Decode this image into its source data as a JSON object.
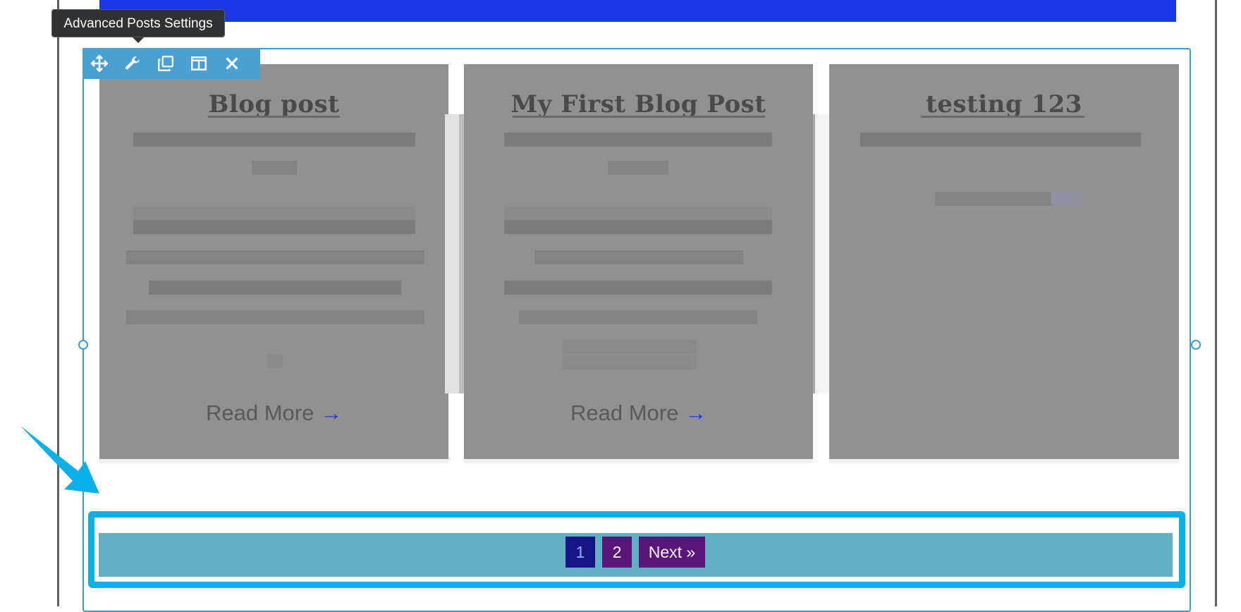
{
  "toolbar": {
    "tooltip": "Advanced Posts Settings",
    "tools": [
      "move-icon",
      "wrench-icon",
      "duplicate-icon",
      "columns-icon",
      "close-icon"
    ]
  },
  "posts": [
    {
      "title": "Blog post",
      "read_more": "Read More",
      "arrow": "→"
    },
    {
      "title": "My First Blog Post",
      "read_more": "Read More",
      "arrow": "→"
    },
    {
      "title": "testing 123"
    }
  ],
  "pagination": {
    "pages": [
      "1",
      "2"
    ],
    "current": "1",
    "next_label": "Next »"
  },
  "colors": {
    "banner": "#1b38e7",
    "toolbar": "#4a9fd3",
    "card": "#919191",
    "pager_bar": "#61b0c4",
    "pager_outline": "#0ab0e8",
    "current_page": "#1a1586",
    "page_button": "#5a157a",
    "callout": "#0ab0e8"
  }
}
